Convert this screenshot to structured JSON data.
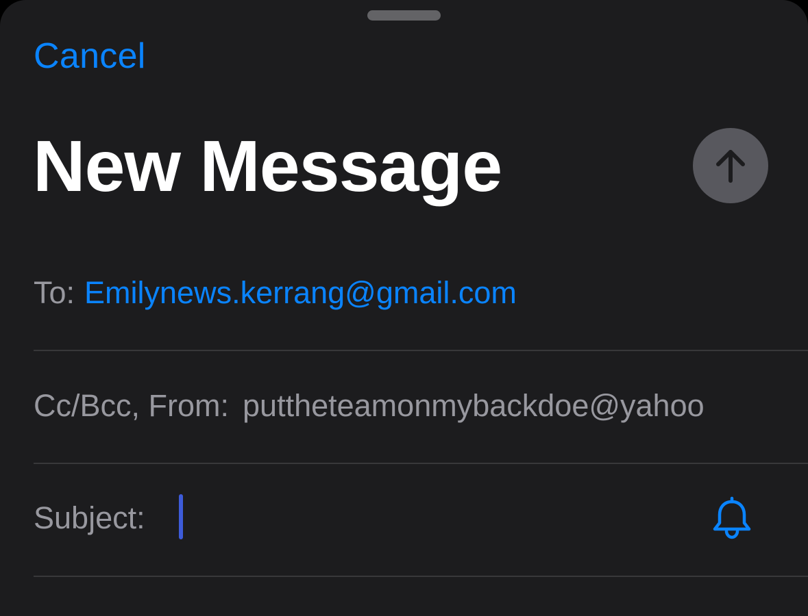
{
  "header": {
    "cancel_label": "Cancel",
    "title": "New Message"
  },
  "icons": {
    "send": "arrow-up-icon",
    "notify": "bell-icon"
  },
  "fields": {
    "to_label": "To:",
    "to_value": "Emilynews.kerrang@gmail.com",
    "cc_from_label": "Cc/Bcc, From:",
    "from_value": "puttheteamonmybackdoe@yahoo",
    "subject_label": "Subject:",
    "subject_value": ""
  },
  "colors": {
    "background": "#1c1c1e",
    "accent": "#0a84ff",
    "label": "#98989f",
    "send_button": "#58585e",
    "cursor": "#3d5bd9"
  }
}
